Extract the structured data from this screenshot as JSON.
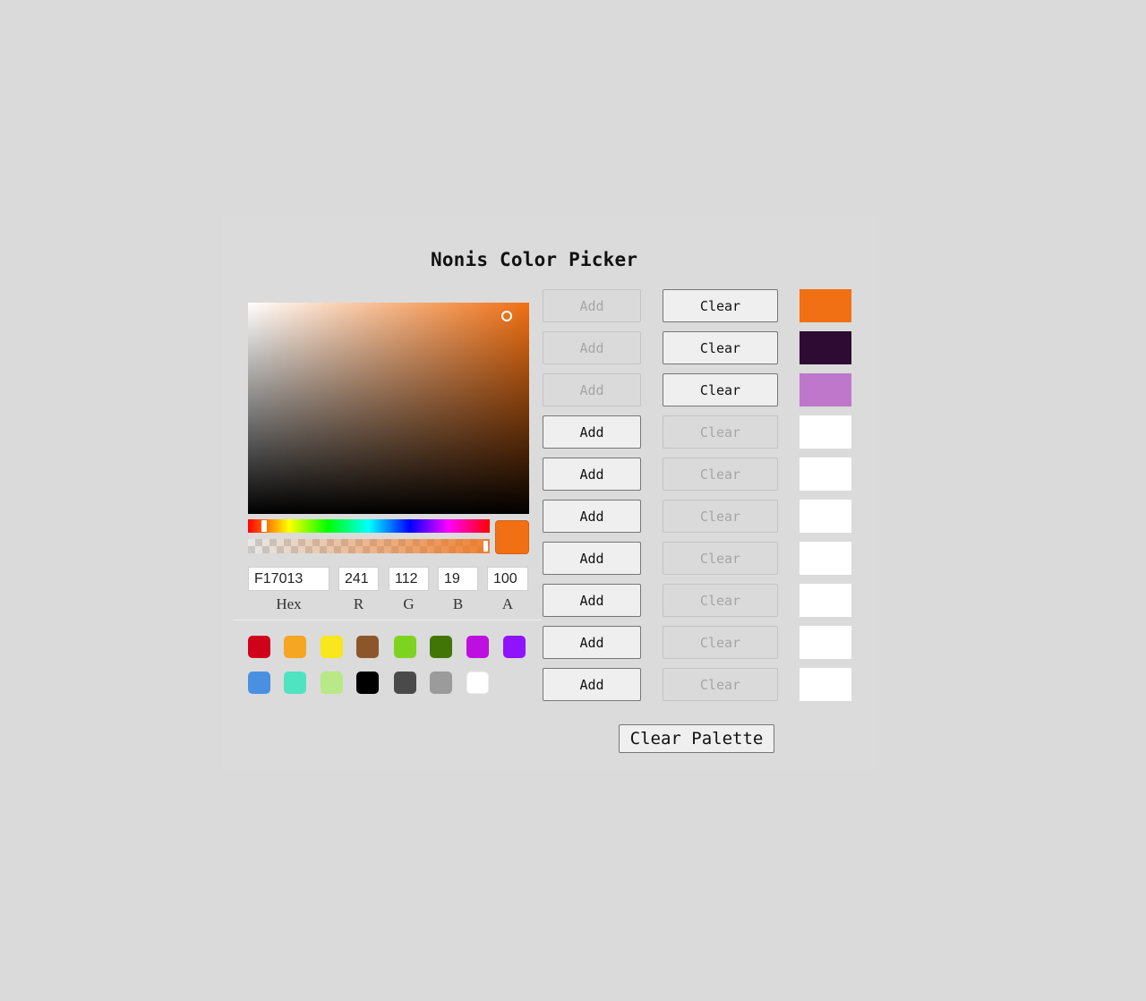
{
  "app": {
    "title": "Nonis Color Picker"
  },
  "picker": {
    "current_color": "#f17013",
    "hue_color": "#f17013",
    "hex": "F17013",
    "r": "241",
    "g": "112",
    "b": "19",
    "a": "100",
    "labels": {
      "hex": "Hex",
      "r": "R",
      "g": "G",
      "b": "B",
      "a": "A"
    }
  },
  "presets": [
    {
      "name": "red",
      "color": "#d0021b"
    },
    {
      "name": "orange",
      "color": "#f5a623"
    },
    {
      "name": "yellow",
      "color": "#f8e71c"
    },
    {
      "name": "brown",
      "color": "#8b572a"
    },
    {
      "name": "lime",
      "color": "#7ed321"
    },
    {
      "name": "dark-green",
      "color": "#417505"
    },
    {
      "name": "magenta",
      "color": "#bd10e0"
    },
    {
      "name": "purple",
      "color": "#9013fe"
    },
    {
      "name": "blue",
      "color": "#4a90e2"
    },
    {
      "name": "teal",
      "color": "#50e3c2"
    },
    {
      "name": "light-green",
      "color": "#b8e986"
    },
    {
      "name": "black",
      "color": "#000000"
    },
    {
      "name": "dark-gray",
      "color": "#4a4a4a"
    },
    {
      "name": "gray",
      "color": "#9b9b9b"
    },
    {
      "name": "white",
      "color": "#ffffff"
    }
  ],
  "palette": {
    "add_label": "Add",
    "clear_label": "Clear",
    "clear_palette_label": "Clear Palette",
    "slots": [
      {
        "color": "#f17013",
        "filled": true
      },
      {
        "color": "#2e0b33",
        "filled": true
      },
      {
        "color": "#bf77cc",
        "filled": true
      },
      {
        "color": "#ffffff",
        "filled": false
      },
      {
        "color": "#ffffff",
        "filled": false
      },
      {
        "color": "#ffffff",
        "filled": false
      },
      {
        "color": "#ffffff",
        "filled": false
      },
      {
        "color": "#ffffff",
        "filled": false
      },
      {
        "color": "#ffffff",
        "filled": false
      },
      {
        "color": "#ffffff",
        "filled": false
      }
    ]
  }
}
